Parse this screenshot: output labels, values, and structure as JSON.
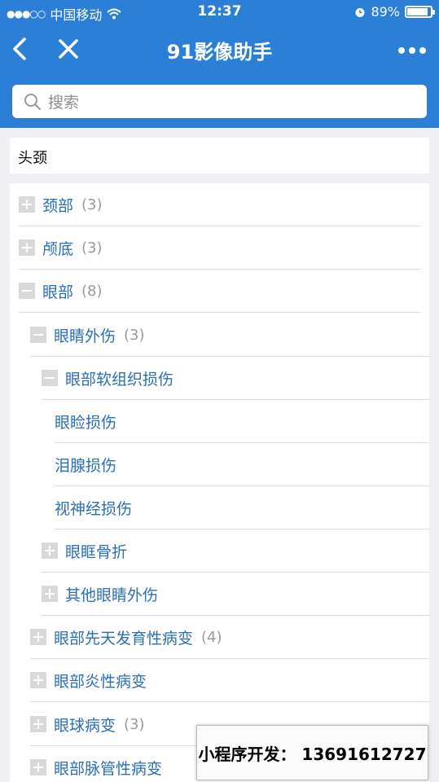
{
  "status": {
    "carrier": "中国移动",
    "time": "12:37",
    "battery": "89%",
    "battery_level": 0.89
  },
  "nav": {
    "title": "91影像助手"
  },
  "search": {
    "placeholder": "搜索"
  },
  "section": {
    "title": "头颈"
  },
  "tree": [
    {
      "label": "颈部",
      "count": "(3)",
      "toggle": "plus"
    },
    {
      "label": "颅底",
      "count": "(3)",
      "toggle": "plus"
    },
    {
      "label": "眼部",
      "count": "(8)",
      "toggle": "minus"
    },
    {
      "label": "眼睛外伤",
      "count": "(3)",
      "toggle": "minus"
    },
    {
      "label": "眼部软组织损伤",
      "count": "",
      "toggle": "minus"
    },
    {
      "label": "眼睑损伤",
      "count": "",
      "toggle": "none"
    },
    {
      "label": "泪腺损伤",
      "count": "",
      "toggle": "none"
    },
    {
      "label": "视神经损伤",
      "count": "",
      "toggle": "none"
    },
    {
      "label": "眼眶骨折",
      "count": "",
      "toggle": "plus"
    },
    {
      "label": "其他眼睛外伤",
      "count": "",
      "toggle": "plus"
    },
    {
      "label": "眼部先天发育性病变",
      "count": "(4)",
      "toggle": "plus"
    },
    {
      "label": "眼部炎性病变",
      "count": "",
      "toggle": "plus"
    },
    {
      "label": "眼球病变",
      "count": "(3)",
      "toggle": "plus"
    },
    {
      "label": "眼部脉管性病变",
      "count": "",
      "toggle": "plus"
    }
  ],
  "watermark": {
    "text": "小程序开发：  13691612727"
  },
  "colors": {
    "header": "#2b7fd6",
    "link": "#2a6fb5",
    "toggle": "#d9d9d9"
  }
}
